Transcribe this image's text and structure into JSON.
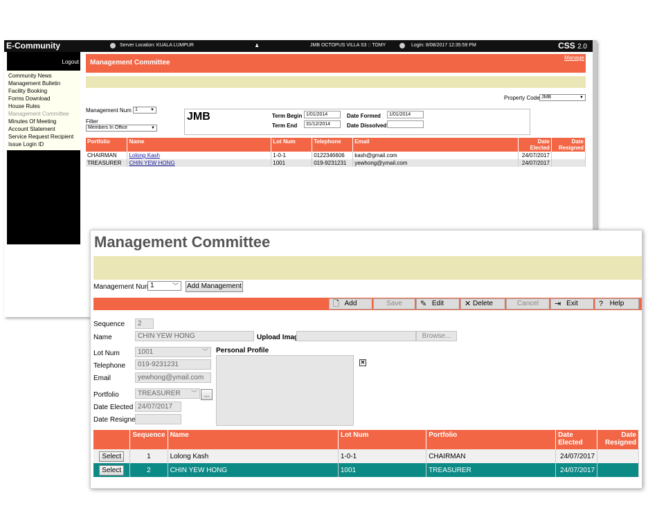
{
  "back": {
    "topbar": {
      "title": "E-Community",
      "server": "Server Location: KUALA LUMPUR",
      "site": "JMB OCTOPUS VILLA S3 :: TOMY",
      "login": "Login: 8/08/2017 12:35:59 PM",
      "brand": "CSS",
      "version": "2.0"
    },
    "logout": "Logout",
    "menu": [
      "Community News",
      "Management Bulletin",
      "Facility Booking",
      "Forms Download",
      "House Rules",
      "Management Committee",
      "Minutes Of Meeting",
      "Account Statement",
      "Service Request Recipient",
      "Issue Login ID"
    ],
    "header": "Management Committee",
    "manage_link": "Manage",
    "property_code_label": "Property Code",
    "property_code_value": "JMB",
    "mgmt_num_label": "Management Num",
    "mgmt_num_value": "1",
    "filter_label": "Filter",
    "filter_value": "Members In Office",
    "jmb": "JMB",
    "term_begin_label": "Term Begin",
    "term_begin": "1/01/2014",
    "term_end_label": "Term End",
    "term_end": "31/12/2014",
    "date_formed_label": "Date Formed",
    "date_formed": "1/01/2014",
    "date_dissolved_label": "Date Dissolved",
    "date_dissolved": "",
    "table": {
      "headers": [
        "Portfolio",
        "Name",
        "Lot Num",
        "Telephone",
        "Email",
        "Date Elected",
        "Date Resigned"
      ],
      "rows": [
        [
          "CHAIRMAN",
          "Lolong Kash",
          "1-0-1",
          "0122346606",
          "kash@gmail.com",
          "24/07/2017",
          ""
        ],
        [
          "TREASURER",
          "CHIN YEW HONG",
          "1001",
          "019-9231231",
          "yewhong@ymail.com",
          "24/07/2017",
          ""
        ]
      ]
    }
  },
  "front": {
    "title": "Management Committee",
    "mgmt_num_label": "Management Num",
    "mgmt_num_value": "1",
    "add_management": "Add Management",
    "toolbar": {
      "add": "Add",
      "save": "Save",
      "edit": "Edit",
      "delete": "Delete",
      "cancel": "Cancel",
      "exit": "Exit",
      "help": "Help"
    },
    "form": {
      "sequence_label": "Sequence",
      "sequence": "2",
      "name_label": "Name",
      "name": "CHIN YEW HONG",
      "upload_label": "Upload Image",
      "upload_value": "",
      "browse": "Browse...",
      "lot_label": "Lot Num",
      "lot": "1001",
      "personal_profile_label": "Personal Profile",
      "telephone_label": "Telephone",
      "telephone": "019-9231231",
      "email_label": "Email",
      "email": "yewhong@ymail.com",
      "portfolio_label": "Portfolio",
      "portfolio": "TREASURER",
      "ellipsis": "...",
      "date_elected_label": "Date Elected",
      "date_elected": "24/07/2017",
      "date_resigned_label": "Date Resigned",
      "date_resigned": ""
    },
    "table": {
      "headers": [
        "",
        "Sequence",
        "Name",
        "Lot Num",
        "Portfolio",
        "Date Elected",
        "Date Resigned"
      ],
      "select_label": "Select",
      "rows": [
        [
          "1",
          "Lolong Kash",
          "1-0-1",
          "CHAIRMAN",
          "24/07/2017",
          ""
        ],
        [
          "2",
          "CHIN YEW HONG",
          "1001",
          "TREASURER",
          "24/07/2017",
          ""
        ]
      ]
    },
    "icons": {
      "add": "new-document-icon",
      "edit": "edit-pencil-icon",
      "delete": "delete-x-icon",
      "exit": "exit-door-icon",
      "help": "help-question-icon",
      "image": "image-placeholder-icon"
    }
  }
}
